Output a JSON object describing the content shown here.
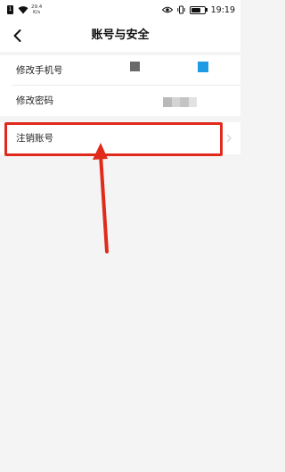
{
  "status_bar": {
    "sim_label": "1",
    "network_speed_value": "29.4",
    "network_speed_unit": "K/s",
    "time": "19:19",
    "battery_level_percent": 80
  },
  "header": {
    "back_icon": "chevron-left-icon",
    "title": "账号与安全"
  },
  "settings": {
    "items": [
      {
        "label": "修改手机号"
      },
      {
        "label": "修改密码"
      }
    ],
    "cancel_account_label": "注销账号"
  },
  "annotation": {
    "highlight_color": "#e02b1c",
    "arrow_color": "#e02b1c"
  }
}
